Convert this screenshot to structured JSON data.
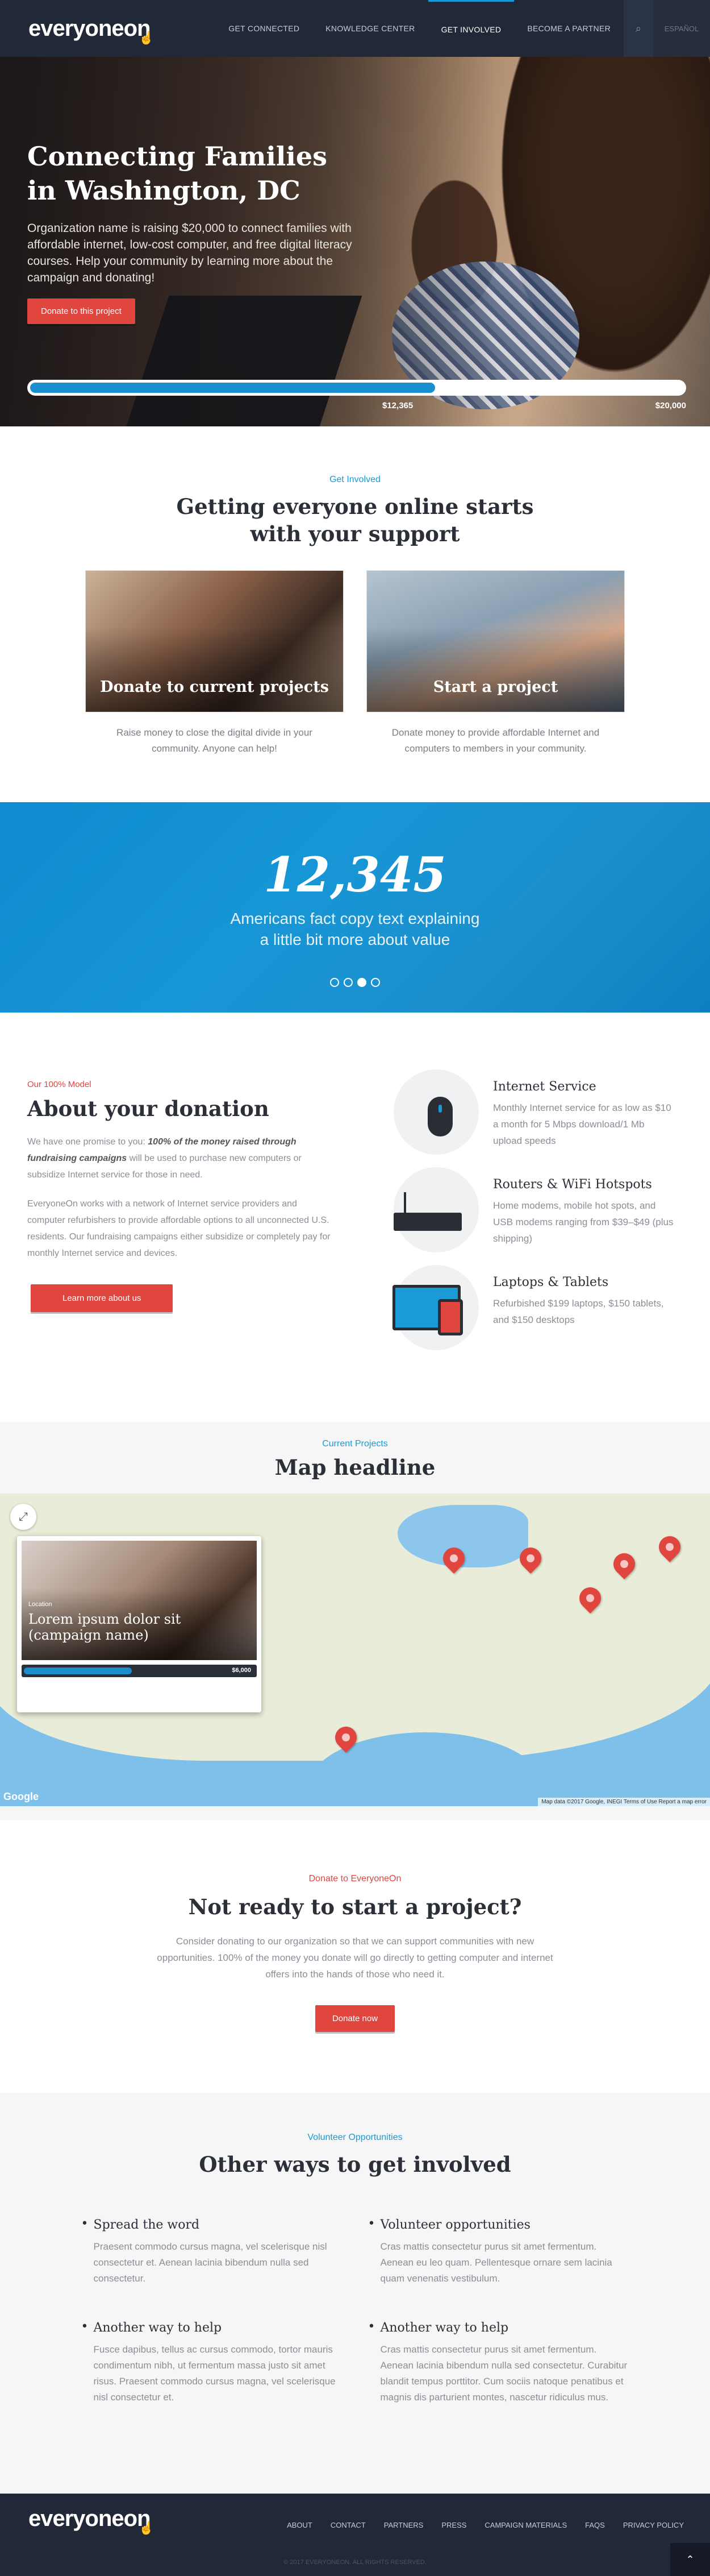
{
  "header": {
    "logo": "everyoneon",
    "nav": [
      "GET CONNECTED",
      "KNOWLEDGE CENTER",
      "GET INVOLVED",
      "BECOME A PARTNER"
    ],
    "active": "GET INVOLVED",
    "language": "ESPAÑOL",
    "icons": {
      "search": "search-icon",
      "logo_hand": "hand-cursor-icon"
    }
  },
  "hero": {
    "title_line1": "Connecting Families",
    "title_line2": "in Washington, DC",
    "text": "Organization name is raising $20,000 to connect families with affordable internet, low-cost computer, and free digital literacy courses. Help your community by learning more about the campaign and donating!",
    "button": "Donate to this project",
    "raised": "$12,365",
    "goal": "$20,000",
    "progress_fraction": 0.62
  },
  "involved": {
    "eyebrow": "Get Involved",
    "title_line1": "Getting everyone online starts",
    "title_line2": "with your support",
    "cards": [
      {
        "title": "Donate to current projects",
        "text": "Raise money to close the digital divide in your community. Anyone can help!"
      },
      {
        "title": "Start a project",
        "text": "Donate money to provide affordable Internet and computers to members in your community."
      }
    ]
  },
  "stats": {
    "number": "12,345",
    "line1": "Americans fact copy text explaining",
    "line2": "a little bit more about value",
    "slides": 4,
    "active_slide": 3
  },
  "donation": {
    "eyebrow": "Our 100% Model",
    "title": "About your donation",
    "p1_a": "We have one promise to you: ",
    "p1_em": "100% of the money raised through fundraising campaigns",
    "p1_b": " will be used to purchase new computers or subsidize Internet service for those in need.",
    "p2": "EveryoneOn works with a network of Internet service providers and computer refurbishers to provide affordable options to all unconnected U.S. residents. Our fundraising campaigns either subsidize or completely pay for monthly Internet service and devices.",
    "button": "Learn more about us",
    "features": [
      {
        "title": "Internet Service",
        "text": "Monthly Internet service for as low as $10 a month for 5 Mbps download/1 Mb upload speeds",
        "icon": "mouse-icon"
      },
      {
        "title": "Routers & WiFi Hotspots",
        "text": "Home modems, mobile hot spots, and USB modems ranging from $39–$49 (plus shipping)",
        "icon": "router-icon"
      },
      {
        "title": "Laptops & Tablets",
        "text": "Refurbished $199 laptops, $150 tablets, and $150 desktops",
        "icon": "laptop-tablet-icon"
      }
    ]
  },
  "map": {
    "eyebrow": "Current Projects",
    "title": "Map headline",
    "popup": {
      "location": "Location",
      "title": "Lorem ipsum dolor sit (campaign name)",
      "amount": "$6,000",
      "progress_fraction": 0.46
    },
    "credit": "Map data ©2017 Google, INEGI",
    "terms": "Terms of Use",
    "report": "Report a map error",
    "google": "Google"
  },
  "notready": {
    "eyebrow": "Donate to EveryoneOn",
    "title": "Not ready to start a project?",
    "text": "Consider donating to our organization so that we can support communities with new opportunities. 100% of the money you donate will go directly to getting computer and internet offers into the hands of those who need it.",
    "button": "Donate now"
  },
  "other": {
    "eyebrow": "Volunteer Opportunities",
    "title": "Other ways to get involved",
    "items": [
      {
        "title": "Spread the word",
        "text": "Praesent commodo cursus magna, vel scelerisque nisl consectetur et. Aenean lacinia bibendum nulla sed consectetur."
      },
      {
        "title": "Volunteer opportunities",
        "text": "Cras mattis consectetur purus sit amet fermentum. Aenean eu leo quam. Pellentesque ornare sem lacinia quam venenatis vestibulum."
      },
      {
        "title": "Another way to help",
        "text": "Fusce dapibus, tellus ac cursus commodo, tortor mauris condimentum nibh, ut fermentum massa justo sit amet risus. Praesent commodo cursus magna, vel scelerisque nisl consectetur et."
      },
      {
        "title": "Another way to help",
        "text": "Cras mattis consectetur purus sit amet fermentum. Aenean lacinia bibendum nulla sed consectetur. Curabitur blandit tempus porttitor. Cum sociis natoque penatibus et magnis dis parturient montes, nascetur ridiculus mus."
      }
    ]
  },
  "footer": {
    "logo": "everyoneon",
    "links": [
      "ABOUT",
      "CONTACT",
      "PARTNERS",
      "PRESS",
      "CAMPAIGN MATERIALS",
      "FAQS",
      "PRIVACY POLICY"
    ],
    "copyright": "© 2017 EVERYONEON. ALL RIGHTS RESERVED.",
    "to_top_icon": "chevron-up-icon"
  },
  "colors": {
    "navy": "#212838",
    "blue": "#1a9ad6",
    "red": "#e0453e"
  }
}
